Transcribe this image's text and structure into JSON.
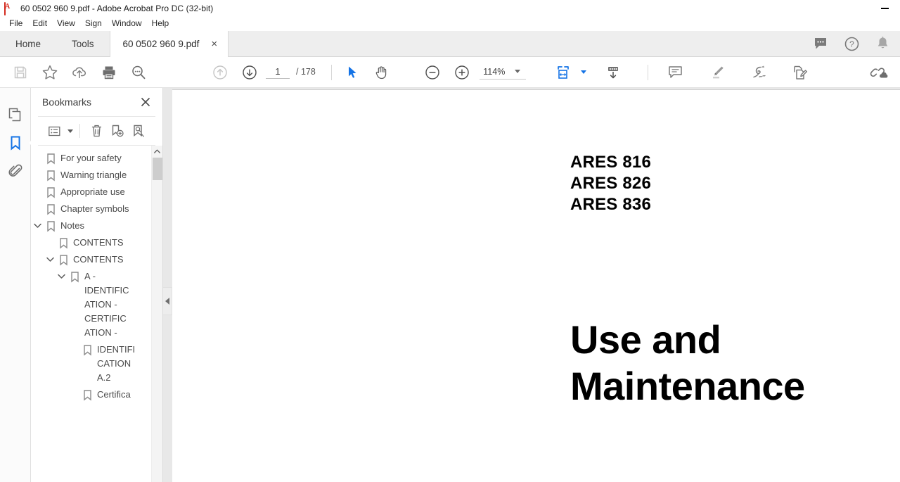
{
  "window": {
    "title": "60 0502 960 9.pdf - Adobe Acrobat Pro DC (32-bit)",
    "app_icon": "acrobat-logo-icon",
    "minimize_label": "—"
  },
  "menubar": {
    "items": [
      {
        "label": "File"
      },
      {
        "label": "Edit"
      },
      {
        "label": "View"
      },
      {
        "label": "Sign"
      },
      {
        "label": "Window"
      },
      {
        "label": "Help"
      }
    ]
  },
  "tabstrip": {
    "home_label": "Home",
    "tools_label": "Tools",
    "document_tab_label": "60 0502 960 9.pdf",
    "document_tab_close": "×",
    "right_icons": [
      {
        "name": "comment-bubble-icon"
      },
      {
        "name": "help-question-icon"
      },
      {
        "name": "notification-bell-icon"
      }
    ]
  },
  "toolbar": {
    "save_icon": "save-floppy-icon",
    "star_icon": "star-icon",
    "upload_icon": "cloud-upload-icon",
    "print_icon": "print-icon",
    "search_icon": "search-magnifier-icon",
    "page_up_icon": "page-up-arrow-icon",
    "page_down_icon": "page-down-arrow-icon",
    "page_number": "1",
    "page_total": "/ 178",
    "select_tool_icon": "select-arrow-icon",
    "hand_tool_icon": "hand-pan-icon",
    "zoom_out_icon": "zoom-out-icon",
    "zoom_in_icon": "zoom-in-icon",
    "zoom_level": "114%",
    "fit_page_icon": "fit-page-icon",
    "page_display_icon": "scroll-page-display-icon",
    "comment_icon": "add-comment-icon",
    "highlight_icon": "highlighter-icon",
    "sign_icon": "sign-signature-icon",
    "edit_pdf_icon": "edit-pdf-icon",
    "share_icon": "share-link-cloud-icon"
  },
  "rail": {
    "items": [
      {
        "name": "page-thumbnails-icon",
        "active": false
      },
      {
        "name": "bookmarks-icon",
        "active": true
      },
      {
        "name": "attachments-paperclip-icon",
        "active": false
      }
    ]
  },
  "bookmarks_panel": {
    "title": "Bookmarks",
    "close_label": "✕",
    "tools": [
      {
        "name": "bookmark-options-menu-icon"
      },
      {
        "name": "delete-bookmark-trash-icon"
      },
      {
        "name": "new-bookmark-icon"
      },
      {
        "name": "find-bookmark-icon"
      }
    ],
    "items": [
      {
        "label": "For your safety",
        "depth": 0,
        "twisty": "none"
      },
      {
        "label": "Warning triangle",
        "depth": 0,
        "twisty": "none"
      },
      {
        "label": "Appropriate use",
        "depth": 0,
        "twisty": "none"
      },
      {
        "label": "Chapter symbols",
        "depth": 0,
        "twisty": "none"
      },
      {
        "label": "Notes",
        "depth": 0,
        "twisty": "expanded"
      },
      {
        "label": "CONTENTS",
        "depth": 1,
        "twisty": "none"
      },
      {
        "label": "CONTENTS",
        "depth": 1,
        "twisty": "expanded"
      },
      {
        "label": "A - IDENTIFICATION - CERTIFICATION -",
        "depth": 2,
        "twisty": "expanded"
      },
      {
        "label": "IDENTIFICATION A.2",
        "depth": 3,
        "twisty": "none"
      },
      {
        "label": "Certifica",
        "depth": 3,
        "twisty": "none"
      }
    ]
  },
  "document": {
    "model_lines": [
      "ARES 816",
      "ARES 826",
      "ARES 836"
    ],
    "title": "Use and Maintenance"
  },
  "colors": {
    "accent_blue": "#1473e6",
    "icon_gray": "#6b6b6b",
    "chrome_gray": "#eeeeee",
    "doc_background": "#e8e8e8",
    "acrobat_red": "#d42b1e"
  }
}
